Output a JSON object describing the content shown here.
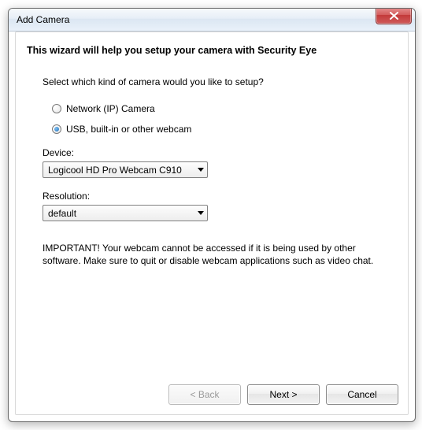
{
  "window": {
    "title": "Add Camera"
  },
  "wizard": {
    "heading": "This wizard will help you setup your camera with Security Eye",
    "prompt": "Select which kind of camera would you like to setup?",
    "options": {
      "network": {
        "label": "Network (IP) Camera",
        "checked": false
      },
      "usb": {
        "label": "USB, built-in or other webcam",
        "checked": true
      }
    },
    "device": {
      "label": "Device:",
      "value": "Logicool HD Pro Webcam C910"
    },
    "resolution": {
      "label": "Resolution:",
      "value": "default"
    },
    "important": "IMPORTANT! Your webcam cannot be accessed if it is being used by other software. Make sure to quit or disable webcam applications such as video chat."
  },
  "buttons": {
    "back": "< Back",
    "next": "Next >",
    "cancel": "Cancel"
  }
}
